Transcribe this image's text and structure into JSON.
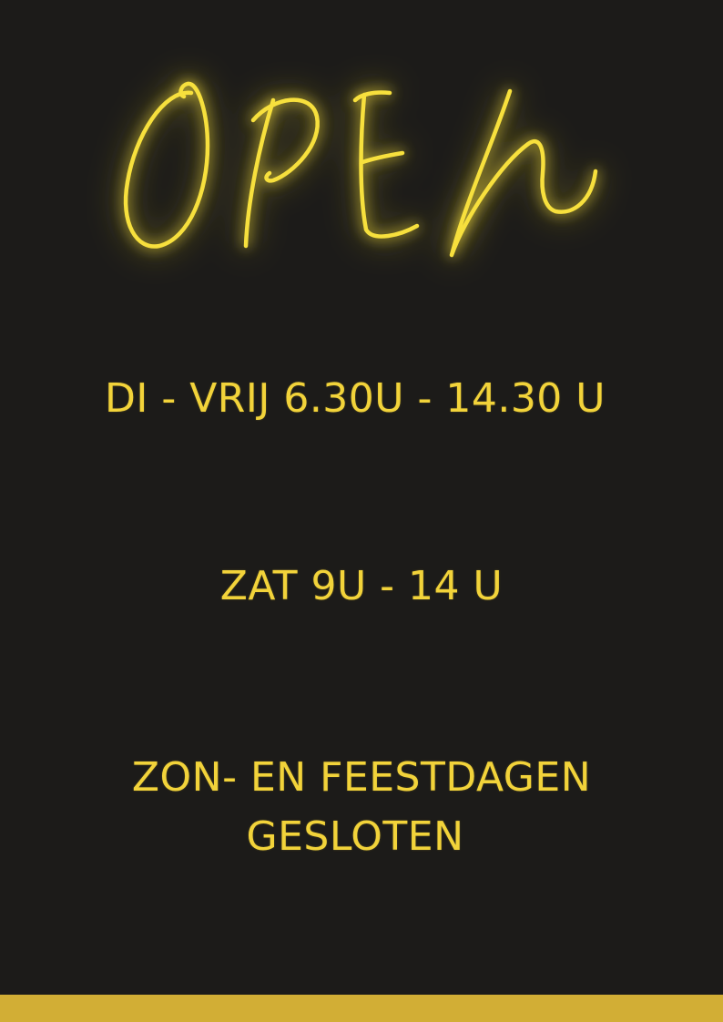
{
  "sign": {
    "word": "OPEN",
    "glow_color": "#f7e03c"
  },
  "hours": {
    "weekdays": "DI - VRIJ 6.30U - 14.30 U",
    "saturday": "ZAT 9U - 14 U",
    "closed_line1": "ZON- EN FEESTDAGEN",
    "closed_line2": "GESLOTEN"
  },
  "colors": {
    "background": "#1c1b19",
    "text": "#f2d33a",
    "bar": "#d2ae35"
  }
}
